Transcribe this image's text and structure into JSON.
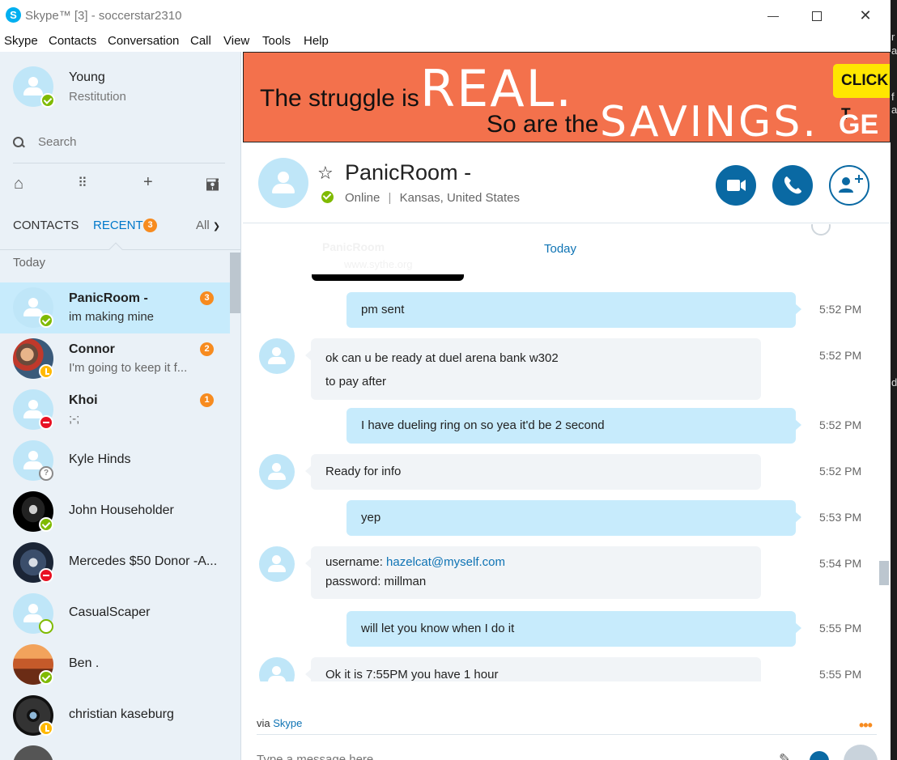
{
  "window": {
    "title": "Skype™ [3] - soccerstar2310",
    "logo_letter": "S"
  },
  "menu": [
    "Skype",
    "Contacts",
    "Conversation",
    "Call",
    "View",
    "Tools",
    "Help"
  ],
  "profile": {
    "name": "Young",
    "mood": "Restitution",
    "status": "online"
  },
  "search": {
    "placeholder": "Search"
  },
  "tabs": {
    "contacts": "CONTACTS",
    "recent": "RECENT",
    "recent_badge": "3",
    "filter": "All"
  },
  "section_label": "Today",
  "contacts": [
    {
      "name": "PanicRoom -",
      "message": "im making mine",
      "badge": "3",
      "status": "online",
      "bold": true,
      "selected": true
    },
    {
      "name": "Connor",
      "message": "I'm going to keep it f...",
      "badge": "2",
      "status": "away",
      "bold": true
    },
    {
      "name": "Khoi",
      "message": ";-;",
      "badge": "1",
      "status": "dnd",
      "bold": true
    },
    {
      "name": "Kyle Hinds",
      "status": "unknown"
    },
    {
      "name": "John Householder",
      "status": "online"
    },
    {
      "name": "Mercedes $50 Donor -A...",
      "status": "dnd"
    },
    {
      "name": "CasualScaper",
      "status": "offline-ring"
    },
    {
      "name": "Ben .",
      "status": "online"
    },
    {
      "name": "christian kaseburg",
      "status": "away"
    }
  ],
  "ad": {
    "line1": "The struggle is",
    "line1_big": "REAL.",
    "line2": "So are the",
    "line2_big": "SAVINGS.",
    "cta": "CLICK T",
    "cta2": "GE"
  },
  "conversation": {
    "name": "PanicRoom -",
    "status": "Online",
    "location": "Kansas, United States",
    "date_divider": "Today",
    "image_preview": {
      "title": "PanicRoom",
      "subtitle": "www.sythe.org"
    },
    "messages": [
      {
        "from": "me",
        "text": "pm sent",
        "time": "5:52 PM"
      },
      {
        "from": "them",
        "text": "ok can u be ready at duel arena bank w302",
        "text2": "to pay after",
        "time": "5:52 PM"
      },
      {
        "from": "me",
        "text": "I have dueling ring on so yea it'd be 2 second",
        "time": "5:52 PM"
      },
      {
        "from": "them",
        "text": "Ready for info",
        "time": "5:52 PM"
      },
      {
        "from": "me",
        "text": "yep",
        "time": "5:53 PM"
      },
      {
        "from": "them",
        "label_user": "username: ",
        "email": "hazelcat@myself.com",
        "text2": "password: millman",
        "time": "5:54 PM"
      },
      {
        "from": "me",
        "text": "will let you know when I do it",
        "time": "5:55 PM"
      },
      {
        "from": "them",
        "text": "Ok it is 7:55PM you have 1 hour",
        "time": "5:55 PM"
      }
    ]
  },
  "compose": {
    "via": "via ",
    "via_link": "Skype",
    "placeholder": "Type a message here"
  },
  "colors": {
    "accent": "#0a69a3",
    "skype_blue": "#00aff0",
    "badge": "#f78b1f",
    "selected": "#c7ebfc",
    "ad_bg": "#f3714c"
  }
}
